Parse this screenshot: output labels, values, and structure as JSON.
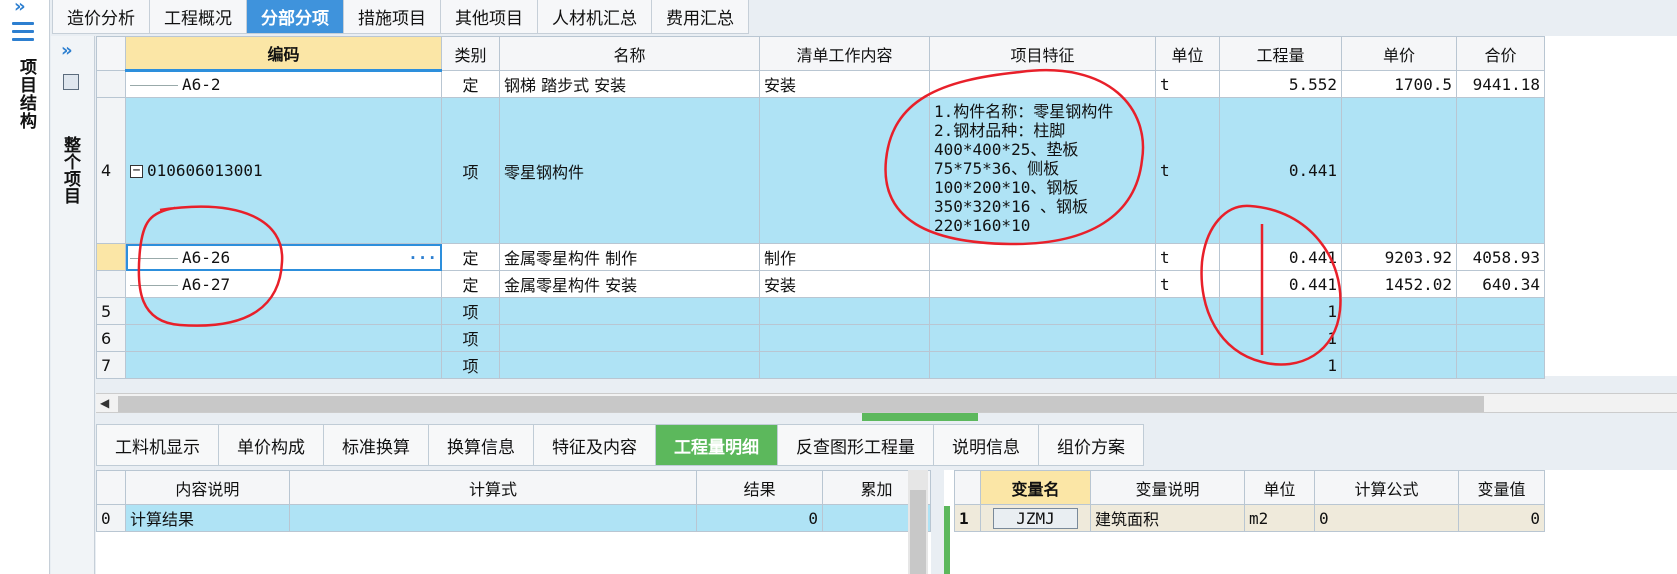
{
  "left_strip": {
    "chevron": "»",
    "title": "项目结构"
  },
  "panel2": {
    "chevron": "»",
    "title": "整个项目"
  },
  "top_tabs": [
    {
      "label": "造价分析",
      "active": false
    },
    {
      "label": "工程概况",
      "active": false
    },
    {
      "label": "分部分项",
      "active": true
    },
    {
      "label": "措施项目",
      "active": false
    },
    {
      "label": "其他项目",
      "active": false
    },
    {
      "label": "人材机汇总",
      "active": false
    },
    {
      "label": "费用汇总",
      "active": false
    }
  ],
  "grid": {
    "headers": [
      "编码",
      "类别",
      "名称",
      "清单工作内容",
      "项目特征",
      "单位",
      "工程量",
      "单价",
      "合价"
    ],
    "rows": [
      {
        "rn": "",
        "code": "A6-2",
        "type": "定",
        "name": "钢梯 踏步式 安装",
        "work": "安装",
        "feature": "",
        "unit": "t",
        "qty": "5.552",
        "price": "1700.5",
        "total": "9441.18"
      },
      {
        "rn": "4",
        "code": "010606013001",
        "type": "项",
        "name": "零星钢构件",
        "work": "",
        "feature": "1.构件名称：零星钢构件\n2.钢材品种：柱脚\n400*400*25、垫板\n75*75*36、侧板\n100*200*10、钢板\n350*320*16 、钢板\n220*160*10",
        "unit": "t",
        "qty": "0.441",
        "price": "",
        "total": ""
      },
      {
        "rn": "",
        "code": "A6-26",
        "type": "定",
        "name": "金属零星构件 制作",
        "work": "制作",
        "feature": "",
        "unit": "t",
        "qty": "0.441",
        "price": "9203.92",
        "total": "4058.93"
      },
      {
        "rn": "",
        "code": "A6-27",
        "type": "定",
        "name": "金属零星构件 安装",
        "work": "安装",
        "feature": "",
        "unit": "t",
        "qty": "0.441",
        "price": "1452.02",
        "total": "640.34"
      },
      {
        "rn": "5",
        "code": "",
        "type": "项",
        "name": "",
        "work": "",
        "feature": "",
        "unit": "",
        "qty": "1",
        "price": "",
        "total": ""
      },
      {
        "rn": "6",
        "code": "",
        "type": "项",
        "name": "",
        "work": "",
        "feature": "",
        "unit": "",
        "qty": "1",
        "price": "",
        "total": ""
      },
      {
        "rn": "7",
        "code": "",
        "type": "项",
        "name": "",
        "work": "",
        "feature": "",
        "unit": "",
        "qty": "1",
        "price": "",
        "total": ""
      }
    ],
    "ellipsis": "···"
  },
  "bottom_tabs": [
    {
      "label": "工料机显示",
      "active": false
    },
    {
      "label": "单价构成",
      "active": false
    },
    {
      "label": "标准换算",
      "active": false
    },
    {
      "label": "换算信息",
      "active": false
    },
    {
      "label": "特征及内容",
      "active": false
    },
    {
      "label": "工程量明细",
      "active": true
    },
    {
      "label": "反查图形工程量",
      "active": false
    },
    {
      "label": "说明信息",
      "active": false
    },
    {
      "label": "组价方案",
      "active": false
    }
  ],
  "detail_left": {
    "headers": [
      "",
      "内容说明",
      "计算式",
      "结果",
      "累加"
    ],
    "rows": [
      {
        "idx": "0",
        "desc": "计算结果",
        "formula": "",
        "result": "0",
        "acc": ""
      }
    ]
  },
  "detail_right": {
    "headers": [
      "",
      "变量名",
      "变量说明",
      "单位",
      "计算公式",
      "变量值"
    ],
    "rows": [
      {
        "idx": "1",
        "var": "JZMJ",
        "desc": "建筑面积",
        "unit": "m2",
        "formula": "0",
        "value": "0"
      }
    ]
  },
  "colors": {
    "accent": "#3f93dc",
    "active_green": "#5cb85c",
    "row_blue": "#afe3f5",
    "header_yellow": "#fbe6a6",
    "annotation_red": "#e8202a"
  }
}
